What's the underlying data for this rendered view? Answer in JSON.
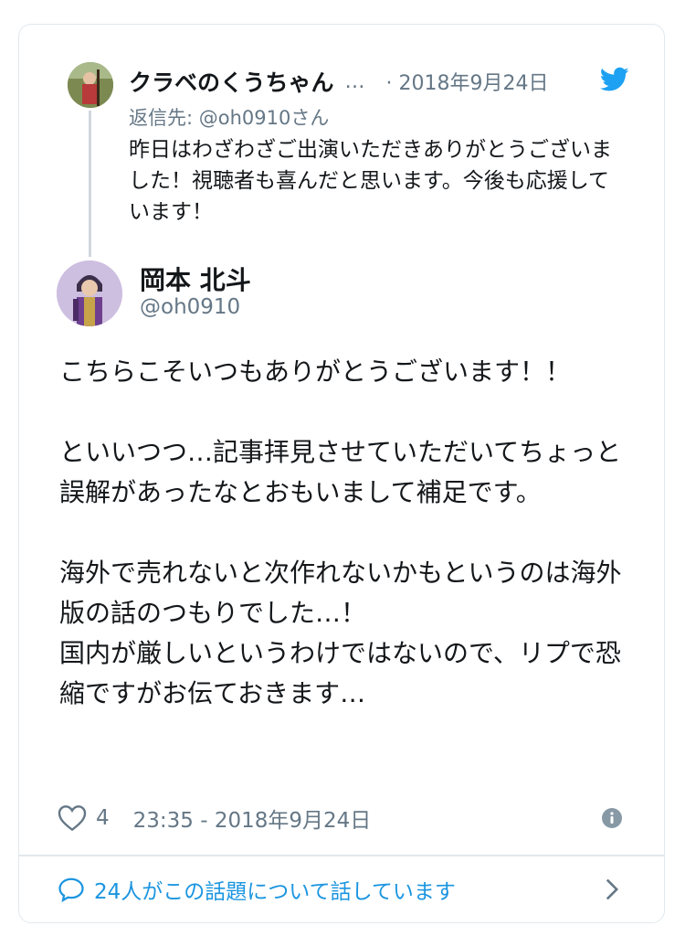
{
  "parent_tweet": {
    "author_name": "クラベのくうちゃん",
    "truncation": "…",
    "date": "· 2018年9月24日",
    "reply_to": "返信先: @oh0910さん",
    "text": "昨日はわざわざご出演いただきありがとうございました！視聴者も喜んだと思います。今後も応援しています！"
  },
  "main_tweet": {
    "author_name": "岡本 北斗",
    "handle": "@oh0910",
    "paragraphs": [
      "こちらこそいつもありがとうございます！！",
      "といいつつ…記事拝見させていただいてちょっと誤解があったなとおもいまして補足です。",
      "海外で売れないと次作れないかもというのは海外版の話のつもりでした…！\n国内が厳しいというわけではないので、リプで恐縮ですがお伝ておきます…"
    ],
    "like_count": "4",
    "timestamp": "23:35 - 2018年9月24日"
  },
  "footer": {
    "conversation_link": "24人がこの話題について話しています"
  },
  "icons": {
    "brand": "twitter-bird-icon",
    "like": "heart-icon",
    "info": "info-icon",
    "conversation": "speech-bubble-icon",
    "navigate": "chevron-right-icon"
  },
  "colors": {
    "brand_blue": "#1da1f2",
    "link_blue": "#1b95e0",
    "secondary_text": "#657786",
    "primary_text": "#14171a",
    "border": "#e1e8ed"
  }
}
